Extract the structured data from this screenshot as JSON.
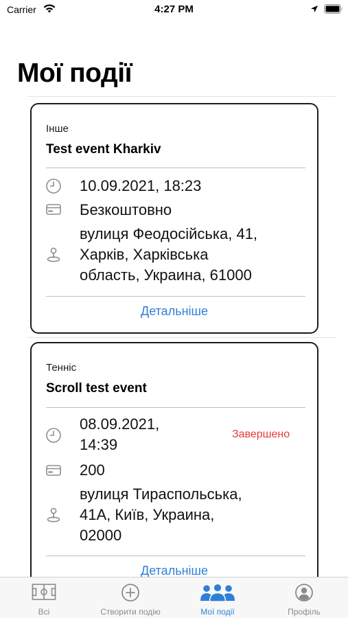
{
  "status_bar": {
    "carrier": "Carrier",
    "time": "4:27 PM"
  },
  "page": {
    "title": "Мої події"
  },
  "events": [
    {
      "category": "Інше",
      "title": "Test event Kharkiv",
      "date_lines": [
        "10.09.2021, 18:23"
      ],
      "price": "Безкоштовно",
      "address_lines": [
        "вулиця Феодосійська, 41,",
        "Харків, Харківська",
        "область, Украина, 61000"
      ],
      "status": "",
      "details_label": "Детальніше"
    },
    {
      "category": "Тенніс",
      "title": "Scroll test event",
      "date_lines": [
        "08.09.2021,",
        "14:39"
      ],
      "price": "200",
      "address_lines": [
        "вулиця Тираспольська,",
        "41А, Київ, Украина,",
        "02000"
      ],
      "status": "Завершено",
      "details_label": "Детальніше"
    }
  ],
  "tab_bar": {
    "tabs": [
      {
        "label": "Всі",
        "icon": "field-icon"
      },
      {
        "label": "Створити подію",
        "icon": "plus-circle-icon"
      },
      {
        "label": "Мої події",
        "icon": "people-icon"
      },
      {
        "label": "Профіль",
        "icon": "person-circle-icon"
      }
    ],
    "active_index": 2
  },
  "colors": {
    "accent": "#2f7fd9",
    "status_finished": "#e63a36",
    "card_border": "#1c1c1c"
  }
}
